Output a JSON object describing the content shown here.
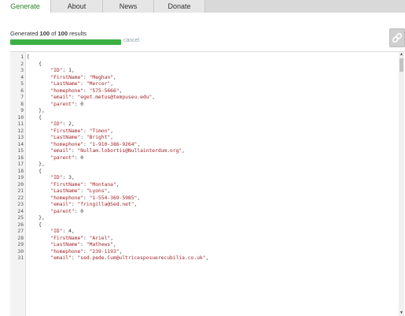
{
  "tabs": [
    {
      "label": "Generate",
      "active": true
    },
    {
      "label": "About",
      "active": false
    },
    {
      "label": "News",
      "active": false
    },
    {
      "label": "Donate",
      "active": false
    }
  ],
  "status": {
    "prefix": "Generated ",
    "count": "100",
    "middle": " of ",
    "total": "100",
    "suffix": " results"
  },
  "progress": {
    "fraction": 1.0
  },
  "cancel_label": "cancel",
  "link_icon": "link-icon",
  "code_lines": [
    "[",
    "    {",
    "        \"ID\": 1,",
    "        \"FirstName\": \"Meghan\",",
    "        \"LastName\": \"Mercer\",",
    "        \"homephone\": \"575-5666\",",
    "        \"email\": \"eget.metus@tempuseu.edu\",",
    "        \"parent\": 0",
    "    },",
    "    {",
    "        \"ID\": 2,",
    "        \"FirstName\": \"Timon\",",
    "        \"LastName\": \"Bright\",",
    "        \"homephone\": \"1-910-386-9264\",",
    "        \"email\": \"Nullam.lobortis@Nullainterdum.org\",",
    "        \"parent\": 0",
    "    },",
    "    {",
    "        \"ID\": 3,",
    "        \"FirstName\": \"Montana\",",
    "        \"LastName\": \"Lyons\",",
    "        \"homephone\": \"1-554-369-5985\",",
    "        \"email\": \"fringilla@Sed.net\",",
    "        \"parent\": 0",
    "    },",
    "    {",
    "        \"ID\": 4,",
    "        \"FirstName\": \"Ariel\",",
    "        \"LastName\": \"Mathews\",",
    "        \"homephone\": \"239-1193\",",
    "        \"email\": \"sed.pede.Cum@ultricesposuerecubilia.co.uk\","
  ]
}
